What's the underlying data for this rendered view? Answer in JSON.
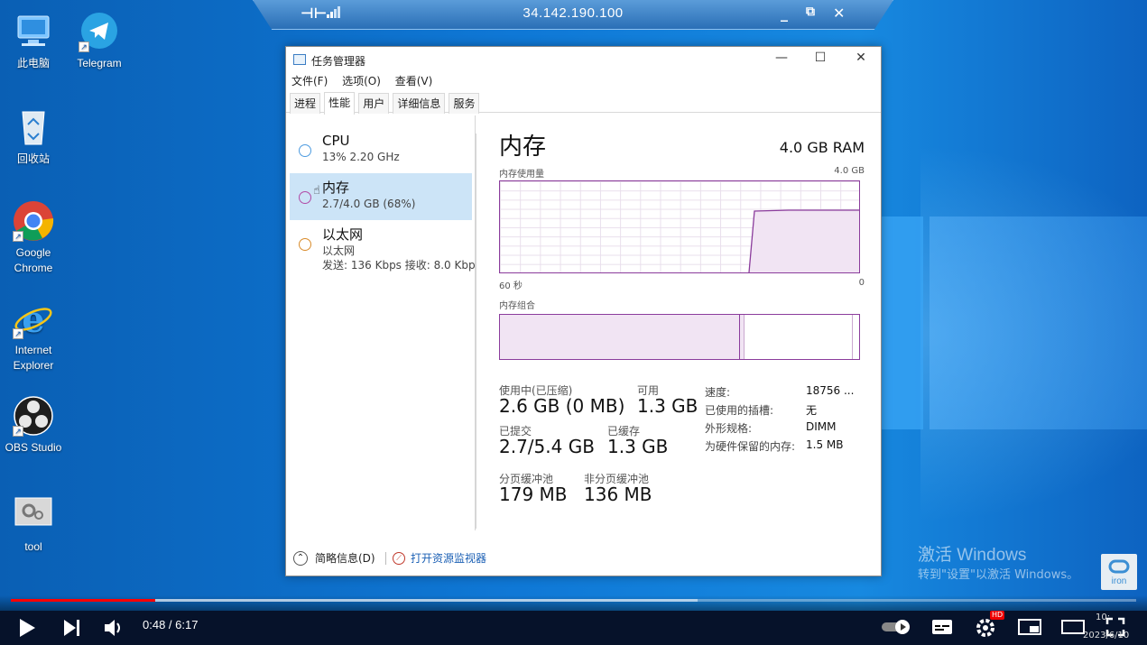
{
  "rdp": {
    "ip": "34.142.190.100"
  },
  "desktop_icons": [
    {
      "label": "此电脑"
    },
    {
      "label": "Telegram"
    },
    {
      "label": "回收站"
    },
    {
      "label": "Google Chrome"
    },
    {
      "label": "Internet Explorer"
    },
    {
      "label": "OBS Studio"
    },
    {
      "label": "tool"
    }
  ],
  "taskmgr": {
    "title": "任务管理器",
    "menu": [
      "文件(F)",
      "选项(O)",
      "查看(V)"
    ],
    "tabs": [
      "进程",
      "性能",
      "用户",
      "详细信息",
      "服务"
    ],
    "active_tab": "性能",
    "resources": [
      {
        "name": "CPU",
        "sub": "13% 2.20 GHz",
        "color": "#4d9be0"
      },
      {
        "name": "内存",
        "sub": "2.7/4.0 GB (68%)",
        "color": "#b14aa6"
      },
      {
        "name": "以太网",
        "sub": "以太网",
        "sub2": "发送: 136 Kbps 接收: 8.0 Kbp",
        "color": "#d98b2b"
      }
    ],
    "memory": {
      "title": "内存",
      "total": "4.0 GB RAM",
      "usage_label": "内存使用量",
      "usage_max": "4.0 GB",
      "x_left": "60 秒",
      "x_right": "0",
      "composition_label": "内存组合",
      "in_use_label": "使用中(已压缩)",
      "in_use_value": "2.6 GB (0 MB)",
      "available_label": "可用",
      "available_value": "1.3 GB",
      "committed_label": "已提交",
      "committed_value": "2.7/5.4 GB",
      "cached_label": "已缓存",
      "cached_value": "1.3 GB",
      "paged_label": "分页缓冲池",
      "paged_value": "179 MB",
      "nonpaged_label": "非分页缓冲池",
      "nonpaged_value": "136 MB",
      "speed_label": "速度:",
      "speed_value": "18756 ...",
      "slots_label": "已使用的插槽:",
      "slots_value": "无",
      "form_label": "外形规格:",
      "form_value": "DIMM",
      "reserved_label": "为硬件保留的内存:",
      "reserved_value": "1.5 MB",
      "usage_fraction": 0.68
    },
    "footer": {
      "brief": "简略信息(D)",
      "open_monitor": "打开资源监视器"
    }
  },
  "watermark": {
    "line1": "激活 Windows",
    "line2": "转到\"设置\"以激活 Windows。"
  },
  "player": {
    "time": "0:48 / 6:17",
    "played_fraction": 0.128,
    "buffered_fraction": 0.61,
    "hd": "HD",
    "clock": "10:",
    "date": "2023/6/10"
  }
}
